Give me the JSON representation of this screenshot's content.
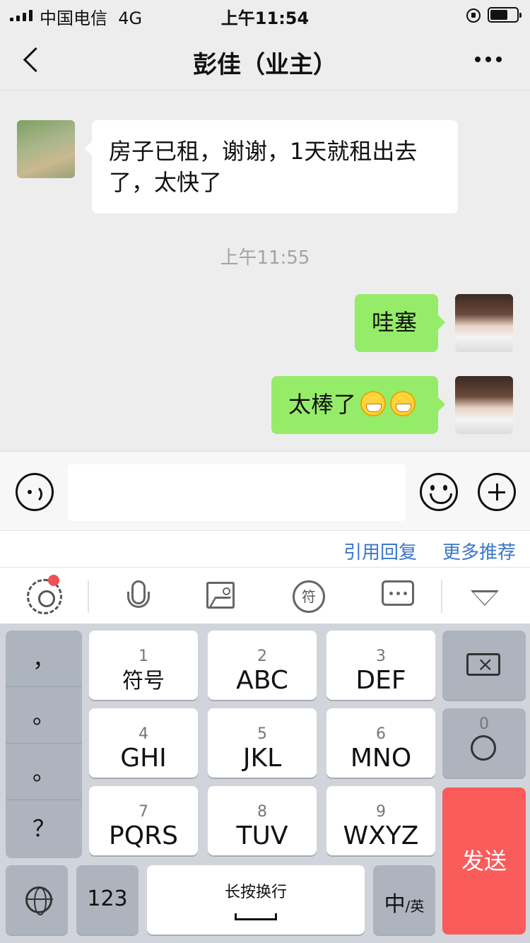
{
  "status_bar": {
    "carrier": "中国电信",
    "network": "4G",
    "time": "上午11:54"
  },
  "nav": {
    "title": "彭佳（业主）"
  },
  "chat": {
    "messages": [
      {
        "side": "left",
        "text": "房子已租，谢谢，1天就租出去了，太快了",
        "line1": "房子已租，谢谢，1天就租出去",
        "line2": "了，太快了"
      },
      {
        "side": "right",
        "text": "哇塞"
      },
      {
        "side": "right",
        "text": "太棒了",
        "emoji_count": 2
      }
    ],
    "timestamp": "上午11:55"
  },
  "composer": {
    "placeholder": ""
  },
  "suggestions": {
    "quote": "引用回复",
    "more": "更多推荐"
  },
  "toolbar": {
    "symbol_label": "符"
  },
  "keyboard": {
    "punct": [
      "，",
      "。",
      "。",
      "？"
    ],
    "keys": [
      {
        "num": "1",
        "label": "符号"
      },
      {
        "num": "2",
        "label": "ABC"
      },
      {
        "num": "3",
        "label": "DEF"
      },
      {
        "num": "4",
        "label": "GHI"
      },
      {
        "num": "5",
        "label": "JKL"
      },
      {
        "num": "6",
        "label": "MNO"
      },
      {
        "num": "7",
        "label": "PQRS"
      },
      {
        "num": "8",
        "label": "TUV"
      },
      {
        "num": "9",
        "label": "WXYZ"
      }
    ],
    "emoji_key_num": "0",
    "send": "发送",
    "num_key": "123",
    "space": "长按换行",
    "lang_main": "中",
    "lang_sub": "/英"
  },
  "colors": {
    "bubble_green": "#95ec69",
    "send_red": "#fa5b5b",
    "link_blue": "#3a78c8"
  }
}
